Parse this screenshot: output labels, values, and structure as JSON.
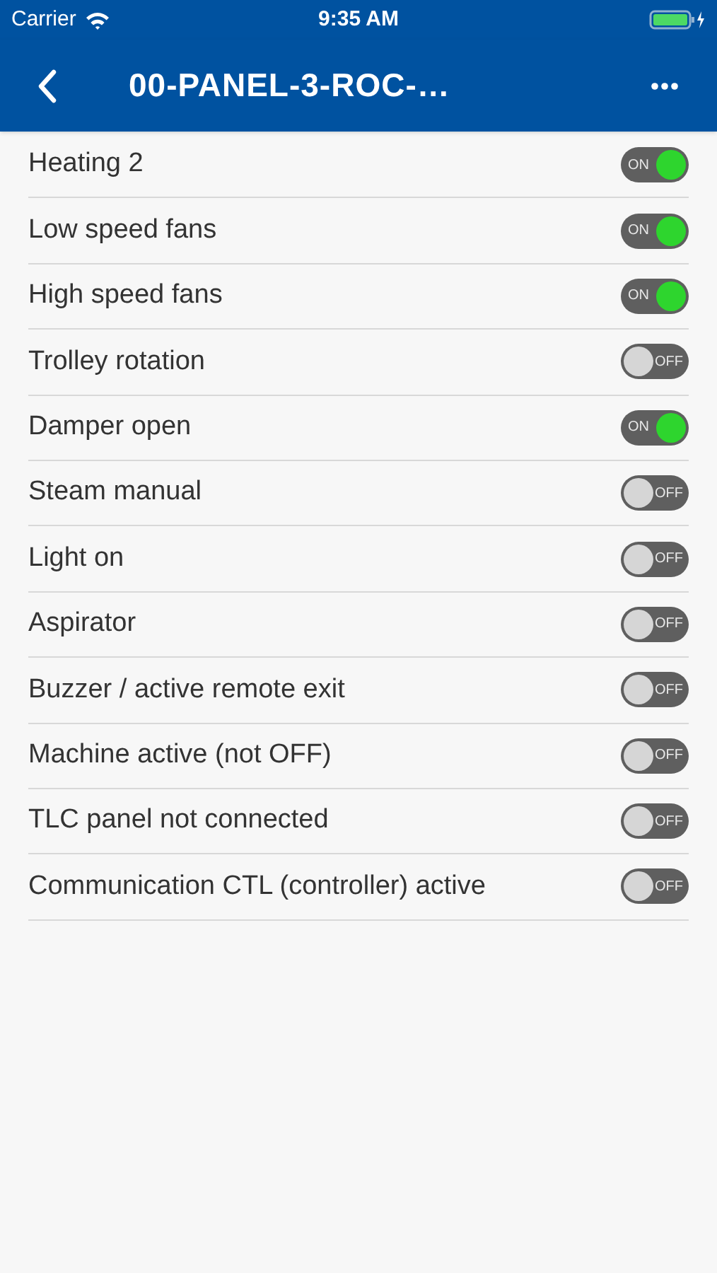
{
  "status_bar": {
    "carrier": "Carrier",
    "time": "9:35 AM"
  },
  "nav_bar": {
    "title": "00-PANEL-3-ROC-…"
  },
  "settings": [
    {
      "label": "Heating 2",
      "on": true,
      "switch_text": "ON"
    },
    {
      "label": "Low speed fans",
      "on": true,
      "switch_text": "ON"
    },
    {
      "label": "High speed fans",
      "on": true,
      "switch_text": "ON"
    },
    {
      "label": "Trolley rotation",
      "on": false,
      "switch_text": "OFF"
    },
    {
      "label": "Damper open",
      "on": true,
      "switch_text": "ON"
    },
    {
      "label": "Steam manual",
      "on": false,
      "switch_text": "OFF"
    },
    {
      "label": "Light on",
      "on": false,
      "switch_text": "OFF"
    },
    {
      "label": "Aspirator",
      "on": false,
      "switch_text": "OFF"
    },
    {
      "label": "Buzzer / active remote exit",
      "on": false,
      "switch_text": "OFF"
    },
    {
      "label": "Machine active (not OFF)",
      "on": false,
      "switch_text": "OFF"
    },
    {
      "label": "TLC panel not connected",
      "on": false,
      "switch_text": "OFF"
    },
    {
      "label": "Communication CTL (controller) active",
      "on": false,
      "switch_text": "OFF"
    }
  ]
}
